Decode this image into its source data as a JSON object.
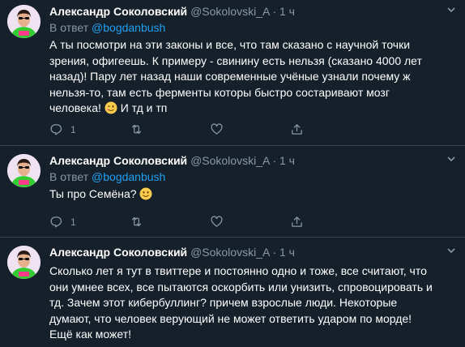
{
  "tweets": [
    {
      "author": "Александр Соколовский",
      "handle": "@Sokolovski_A",
      "dot": "·",
      "time": "1 ч",
      "reply_prefix": "В ответ",
      "reply_to": "@bogdanbush",
      "text_lines": [
        "А ты посмотри на эти законы и все, что там сказано с научной точки",
        "зрения, офигеешь. К примеру - свинину есть нельзя (сказано 4000 лет",
        "назад)! Пару лет назад наши современные учёные узнали почему ж",
        "нельзя-то, там есть ферменты которы быстро состаривают мозг",
        "человека!"
      ],
      "text_tail": "И тд и тп",
      "emoji": "winking-face",
      "reply_count": "1",
      "retweet_count": "",
      "like_count": ""
    },
    {
      "author": "Александр Соколовский",
      "handle": "@Sokolovski_A",
      "dot": "·",
      "time": "1 ч",
      "reply_prefix": "В ответ",
      "reply_to": "@bogdanbush",
      "text": "Ты про Семёна?",
      "emoji": "smiling-face",
      "reply_count": "1",
      "retweet_count": "",
      "like_count": ""
    },
    {
      "author": "Александр Соколовский",
      "handle": "@Sokolovski_A",
      "dot": "·",
      "time": "1 ч",
      "text_lines": [
        "Сколько лет я тут в твиттере и постоянно одно и тоже, все считают, что",
        "они умнее всех, все пытаются оскорбить или унизить, спровоцировать и",
        "тд. Зачем этот кибербуллинг? причем взрослые люди. Некоторые",
        "думают, что человек верующий не может ответить ударом по морде!",
        "Ещё как может!"
      ]
    }
  ],
  "colors": {
    "background": "#15202b",
    "secondary_text": "#8899a6",
    "accent": "#1da1f2",
    "divider": "#38444d"
  }
}
